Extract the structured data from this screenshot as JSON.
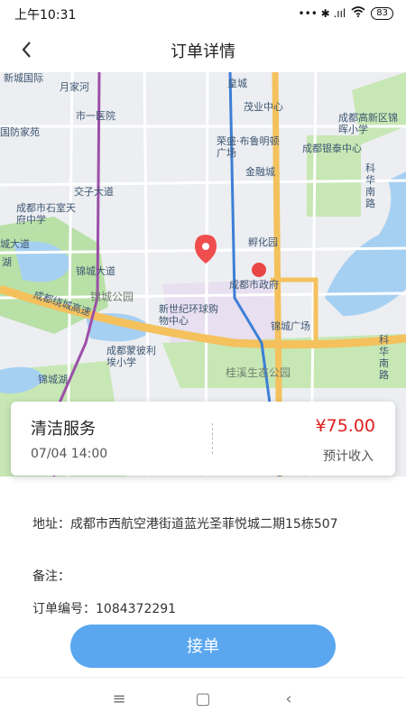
{
  "status": {
    "time": "上午10:31",
    "signal_text": "••• ✱ .ııl ",
    "battery": "83"
  },
  "nav": {
    "title": "订单详情"
  },
  "map_labels": [
    "新城国际",
    "月家河",
    "市一医院",
    "国防家苑",
    "皇城",
    "茂业中心",
    "成都高新区锦晖小学",
    "荣盛·布鲁明顿广场",
    "成都银泰中心",
    "金融城",
    "科华南路",
    "交子大道",
    "成都市石室天府中学",
    "城大道",
    "孵化园",
    "锦城大道",
    "成都市政府",
    "锦城公园",
    "成都绕城高速",
    "新世纪环球购物中心",
    "锦城广场",
    "成都蒙彼利埃小学",
    "锦城湖",
    "桂溪生态公园",
    "科华南路",
    "湖"
  ],
  "order": {
    "service": "清洁服务",
    "time": "07/04 14:00",
    "price": "¥75.00",
    "income_label": "预计收入"
  },
  "details": {
    "address": "地址：成都市西航空港街道蓝光圣菲悦城二期15栋507",
    "remark": "备注：",
    "order_no": "订单编号：1084372291"
  },
  "actions": {
    "accept": "接单"
  },
  "system_nav": {
    "menu": "≡",
    "home": "▢",
    "back": "‹"
  },
  "colors": {
    "accent": "#5aa7f0",
    "price": "#e02020"
  }
}
